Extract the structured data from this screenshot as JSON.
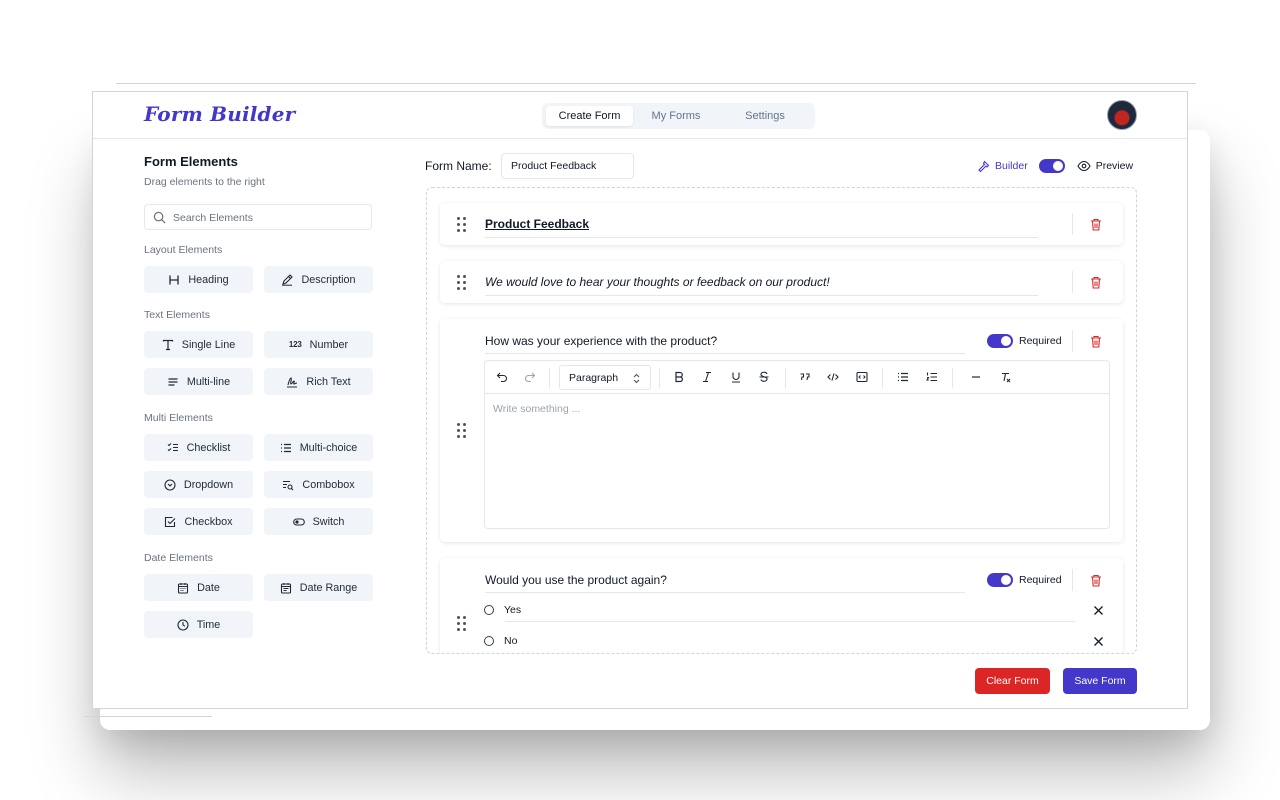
{
  "app": {
    "title": "Form Builder"
  },
  "nav": {
    "tabs": [
      {
        "label": "Create Form",
        "active": true
      },
      {
        "label": "My Forms",
        "active": false
      },
      {
        "label": "Settings",
        "active": false
      }
    ]
  },
  "sidebar": {
    "title": "Form Elements",
    "subtitle": "Drag elements to the right",
    "search_placeholder": "Search Elements",
    "groups": {
      "layout": {
        "label": "Layout Elements",
        "items": [
          {
            "label": "Heading",
            "icon": "heading-icon"
          },
          {
            "label": "Description",
            "icon": "pencil-icon"
          }
        ]
      },
      "text": {
        "label": "Text Elements",
        "items": [
          {
            "label": "Single Line",
            "icon": "text-type-icon"
          },
          {
            "label": "Number",
            "icon": "number-icon",
            "glyph": "123"
          },
          {
            "label": "Multi-line",
            "icon": "lines-icon"
          },
          {
            "label": "Rich Text",
            "icon": "signature-icon"
          }
        ]
      },
      "multi": {
        "label": "Multi Elements",
        "items": [
          {
            "label": "Checklist",
            "icon": "checklist-icon"
          },
          {
            "label": "Multi-choice",
            "icon": "list-icon"
          },
          {
            "label": "Dropdown",
            "icon": "chevron-circle-icon"
          },
          {
            "label": "Combobox",
            "icon": "search-list-icon"
          },
          {
            "label": "Checkbox",
            "icon": "checkbox-icon"
          },
          {
            "label": "Switch",
            "icon": "toggle-icon"
          }
        ]
      },
      "date": {
        "label": "Date Elements",
        "items": [
          {
            "label": "Date",
            "icon": "calendar-icon"
          },
          {
            "label": "Date Range",
            "icon": "calendar-range-icon"
          },
          {
            "label": "Time",
            "icon": "clock-icon"
          }
        ]
      }
    }
  },
  "form": {
    "name_label": "Form Name:",
    "name_value": "Product Feedback",
    "mode": {
      "builder_label": "Builder",
      "preview_label": "Preview",
      "builder_active": true
    },
    "heading_text": "Product Feedback",
    "description_text": "We would love to hear your thoughts or feedback on our product!",
    "question1": {
      "text": "How was your experience with the product?",
      "required_label": "Required",
      "required": true,
      "editor": {
        "format_value": "Paragraph",
        "placeholder": "Write something ..."
      }
    },
    "question2": {
      "text": "Would you use the product again?",
      "required_label": "Required",
      "required": true,
      "options": [
        "Yes",
        "No"
      ]
    }
  },
  "actions": {
    "clear_label": "Clear Form",
    "save_label": "Save Form"
  },
  "colors": {
    "accent": "#4338ca",
    "danger": "#dc2626",
    "chip_bg": "#f1f5f9"
  }
}
